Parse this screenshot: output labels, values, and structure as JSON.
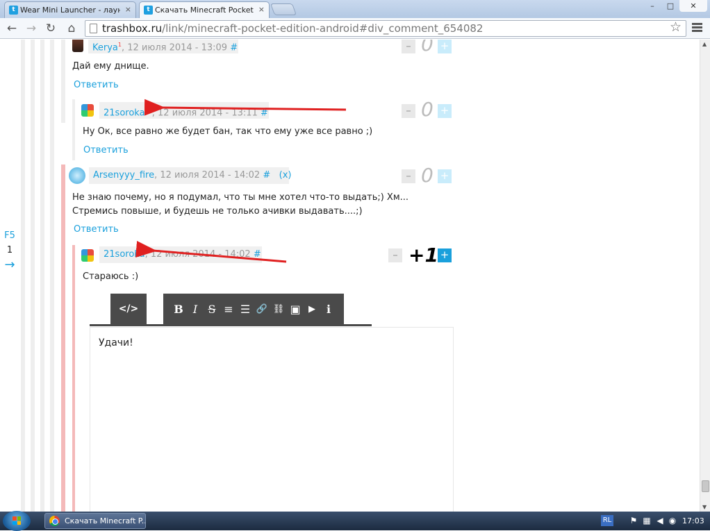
{
  "browser": {
    "tabs": [
      {
        "label": "Wear Mini Launcher - лаунче",
        "active": false
      },
      {
        "label": "Скачать Minecraft Pocket Ed",
        "active": true
      }
    ],
    "url_host": "trashbox.ru",
    "url_path": "/link/minecraft-pocket-edition-android#div_comment_654082",
    "buttons": {
      "back": "←",
      "forward": "→",
      "reload": "↻",
      "home": "⌂",
      "star": "☆",
      "minimize": "–",
      "maximize": "□",
      "close": "✕",
      "tab_close": "×"
    }
  },
  "side_pager": {
    "refresh": "F5",
    "page": "1",
    "next": "→"
  },
  "comments": [
    {
      "author": "Kerya",
      "rank": "1",
      "date": ", 12 июля 2014 - 13:09",
      "hash": "#",
      "score": "0",
      "text": [
        "Дай ему днище."
      ],
      "reply": "Ответить"
    },
    {
      "author": "21soroka",
      "rank": "15",
      "date": ", 12 июля 2014 - 13:11",
      "hash": "#",
      "score": "0",
      "text": [
        "Ну Ок, все равно же будет бан, так что ему уже все равно ;)"
      ],
      "reply": "Ответить"
    },
    {
      "author": "Arsenyyy_fire",
      "rank": "",
      "date": ", 12 июля 2014 - 14:02",
      "hash": "#",
      "extra": "(x)",
      "score": "0",
      "text": [
        "Не знаю почему, но я подумал, что ты мне хотел что-то выдать;) Хм...",
        "Стремись повыше, и будешь не только ачивки выдавать....;)"
      ],
      "reply": "Ответить"
    },
    {
      "author": "21soroka",
      "rank": "",
      "date": ", 12 июля 2014 - 14:02",
      "hash": "#",
      "score": "+1",
      "text": [
        "Стараюсь :)"
      ],
      "reply": ""
    }
  ],
  "vote": {
    "minus": "–",
    "plus": "+"
  },
  "editor": {
    "source_button": "</>",
    "tools": [
      "B",
      "I",
      "S",
      "≡",
      "☰",
      "🔗",
      "⛓",
      "▣",
      "▶",
      "ℹ"
    ],
    "content": "Удачи!"
  },
  "taskbar": {
    "task_label": "Скачать Minecraft P...",
    "lang": "RL",
    "clock": "17:03"
  },
  "colors": {
    "accent": "#1aa0dc",
    "arrow": "#e02020",
    "thread_pink": "#f4b9b9"
  }
}
